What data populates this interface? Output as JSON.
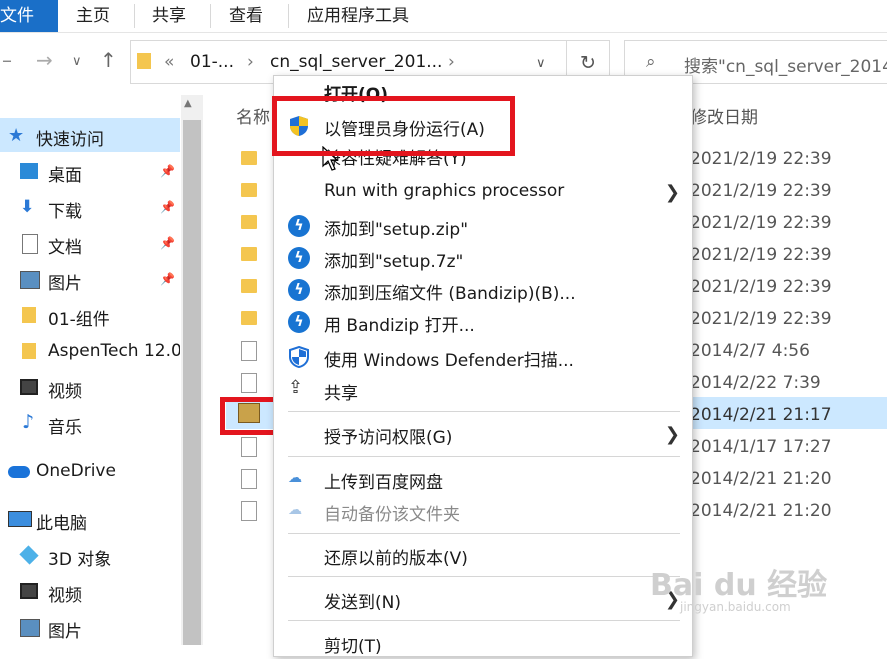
{
  "ribbon": {
    "tabs": [
      "文件",
      "主页",
      "共享",
      "查看",
      "应用程序工具"
    ]
  },
  "address": {
    "parts": [
      "«",
      "01-...",
      "›",
      "cn_sql_server_201...",
      "›"
    ]
  },
  "search": {
    "placeholder": "搜索\"cn_sql_server_2014"
  },
  "list_header": {
    "name": "名称",
    "date": "修改日期"
  },
  "sidebar": {
    "items": [
      {
        "label": "快速访问",
        "icon": "star-icon"
      },
      {
        "label": "桌面",
        "icon": "desktop-icon",
        "pinned": true
      },
      {
        "label": "下载",
        "icon": "download-icon",
        "pinned": true
      },
      {
        "label": "文档",
        "icon": "document-icon",
        "pinned": true
      },
      {
        "label": "图片",
        "icon": "pictures-icon",
        "pinned": true
      },
      {
        "label": "01-组件",
        "icon": "folder-icon"
      },
      {
        "label": "AspenTech 12.0",
        "icon": "folder-icon"
      },
      {
        "label": "视频",
        "icon": "video-icon"
      },
      {
        "label": "音乐",
        "icon": "music-icon"
      },
      {
        "label": "OneDrive",
        "icon": "cloud-icon"
      },
      {
        "label": "此电脑",
        "icon": "computer-icon"
      },
      {
        "label": "3D 对象",
        "icon": "cube-icon"
      },
      {
        "label": "视频",
        "icon": "video-icon"
      },
      {
        "label": "图片",
        "icon": "pictures-icon"
      }
    ]
  },
  "files": [
    {
      "date": "2021/2/19 22:39"
    },
    {
      "date": "2021/2/19 22:39"
    },
    {
      "date": "2021/2/19 22:39"
    },
    {
      "date": "2021/2/19 22:39"
    },
    {
      "date": "2021/2/19 22:39"
    },
    {
      "date": "2021/2/19 22:39"
    },
    {
      "date": "2014/2/7 4:56"
    },
    {
      "date": "2014/2/22 7:39"
    },
    {
      "date": "2014/2/21 21:17"
    },
    {
      "date": "2014/1/17 17:27"
    },
    {
      "date": "2014/2/21 21:20"
    },
    {
      "date": "2014/2/21 21:20"
    }
  ],
  "menu": {
    "items": [
      {
        "label": "打开(O)"
      },
      {
        "label": "以管理员身份运行(A)",
        "icon": "uac-shield-icon"
      },
      {
        "label": "兼容性疑难解答(Y)"
      },
      {
        "label": "Run with graphics processor",
        "submenu": true
      },
      {
        "label": "添加到\"setup.zip\"",
        "icon": "bandizip-icon"
      },
      {
        "label": "添加到\"setup.7z\"",
        "icon": "bandizip-icon"
      },
      {
        "label": "添加到压缩文件 (Bandizip)(B)...",
        "icon": "bandizip-icon"
      },
      {
        "label": "用 Bandizip 打开...",
        "icon": "bandizip-icon"
      },
      {
        "label": "使用 Windows Defender扫描...",
        "icon": "defender-icon"
      },
      {
        "label": "共享",
        "icon": "share-icon"
      },
      {
        "label": "授予访问权限(G)",
        "submenu": true
      },
      {
        "label": "上传到百度网盘",
        "icon": "baidu-cloud-icon"
      },
      {
        "label": "自动备份该文件夹",
        "icon": "baidu-cloud-icon",
        "disabled": true
      },
      {
        "label": "还原以前的版本(V)"
      },
      {
        "label": "发送到(N)",
        "submenu": true
      },
      {
        "label": "剪切(T)"
      }
    ]
  },
  "watermark": {
    "text": "Bai du 经验",
    "sub": "jingyan.baidu.com"
  },
  "colors": {
    "accent": "#1a6fc8",
    "highlight": "#e3151e",
    "selected": "#cce8ff"
  }
}
